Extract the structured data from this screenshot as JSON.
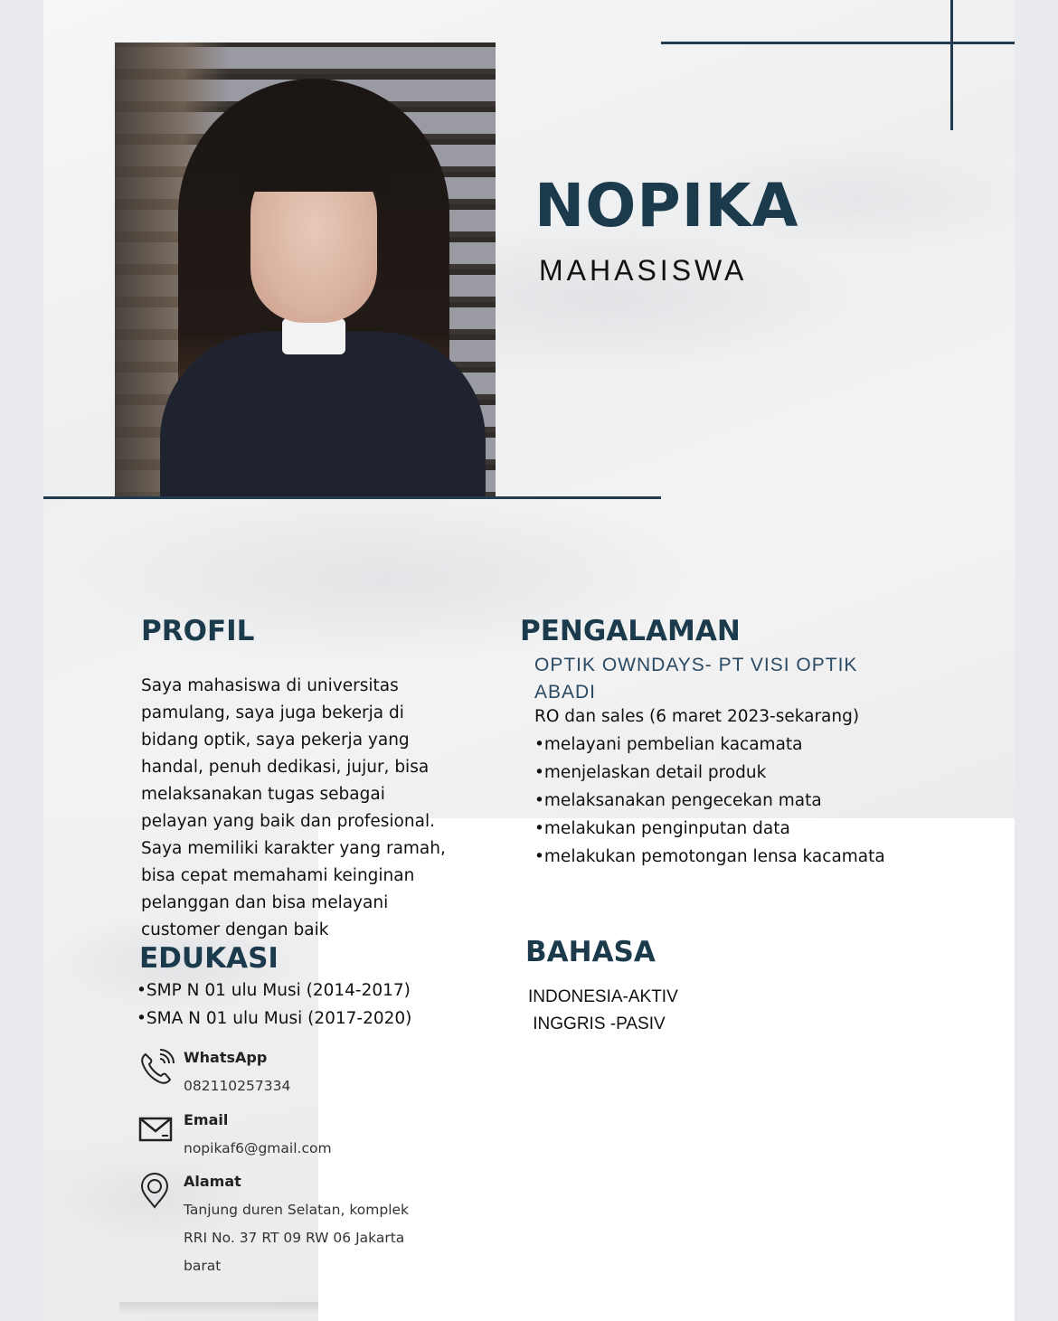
{
  "header": {
    "name": "NOPIKA",
    "role": "MAHASISWA"
  },
  "photo": {
    "alt": "Foto profil Nopika"
  },
  "profil": {
    "title": "PROFIL",
    "text": "Saya mahasiswa di universitas pamulang, saya juga bekerja di bidang optik, saya pekerja yang handal, penuh dedikasi, jujur, bisa melaksanakan tugas sebagai pelayan yang baik dan profesional. Saya memiliki karakter yang ramah, bisa cepat memahami keinginan pelanggan dan bisa melayani customer dengan baik"
  },
  "pengalaman": {
    "title": "PENGALAMAN",
    "company": "OPTIK OWNDAYS- PT VISI OPTIK ABADI",
    "lines": [
      "RO dan sales (6 maret 2023-sekarang)",
      "•melayani pembelian kacamata",
      "•menjelaskan detail produk",
      "•melaksanakan pengecekan mata",
      "•melakukan penginputan data",
      "•melakukan pemotongan lensa kacamata"
    ]
  },
  "edukasi": {
    "title": "EDUKASI",
    "items": [
      "•SMP N 01 ulu Musi (2014-2017)",
      "•SMA N 01 ulu Musi (2017-2020)"
    ]
  },
  "bahasa": {
    "title": "BAHASA",
    "items": [
      "INDONESIA-AKTIV",
      " INGGRIS -PASIV"
    ]
  },
  "contacts": {
    "whatsapp": {
      "label": "WhatsApp",
      "value": "082110257334",
      "icon": "phone-icon"
    },
    "email": {
      "label": "Email",
      "value": "nopikaf6@gmail.com",
      "icon": "mail-icon"
    },
    "alamat": {
      "label": "Alamat",
      "value": "Tanjung duren Selatan, komplek RRI No. 37 RT 09 RW 06 Jakarta barat",
      "icon": "location-pin-icon"
    }
  },
  "colors": {
    "accent": "#1b3a4c",
    "subheading": "#2b4a63",
    "line": "#223a4d"
  }
}
